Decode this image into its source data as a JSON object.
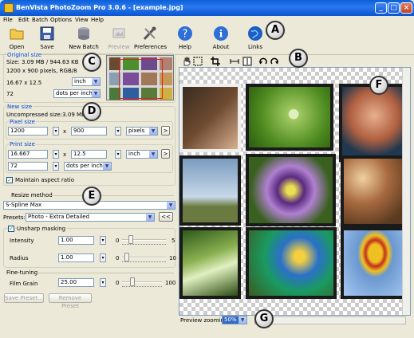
{
  "window": {
    "title": "BenVista PhotoZoom Pro 3.0.6 - [example.jpg]",
    "minimize": "_",
    "maximize": "□",
    "close": "×"
  },
  "menu": [
    "File",
    "Edit",
    "Batch",
    "Options",
    "View",
    "Help"
  ],
  "toolbar": {
    "open": "Open",
    "save": "Save",
    "new_batch": "New Batch",
    "preview": "Preview",
    "preferences": "Preferences",
    "help": "Help",
    "about": "About",
    "links": "Links"
  },
  "original_size": {
    "heading": "Original size",
    "size_line": "Size: 3.09 MB / 944.63 KB",
    "pixels_line": "1200 x 900 pixels, RGB/8",
    "dims": "16.67 x 12.5",
    "unit": "inch",
    "resolution": "72",
    "res_unit": "dots per inch"
  },
  "new_size": {
    "heading": "New size",
    "uncompressed": "Uncompressed size:3.09 MB",
    "pixel_size_label": "Pixel size",
    "px_width": "1200",
    "px_height": "900",
    "px_unit": "pixels",
    "print_size_label": "Print size",
    "print_width": "16.667",
    "print_height": "12.5",
    "print_unit": "inch",
    "print_res": "72",
    "print_res_unit": "dots per inch",
    "x": "x",
    "go": ">",
    "maintain_aspect": "Maintain aspect ratio"
  },
  "resize": {
    "heading": "Resize method",
    "method": "S-Spline Max",
    "presets_label": "Presets:",
    "preset": "Photo - Extra Detailed",
    "preset_btn": "<<",
    "unsharp_label": "Unsharp masking",
    "intensity_label": "Intensity",
    "intensity_value": "1.00",
    "intensity_min": "0",
    "intensity_max": "5",
    "intensity_level": 0.2,
    "radius_label": "Radius",
    "radius_value": "1.00",
    "radius_min": "0",
    "radius_max": "10",
    "radius_level": 0.1,
    "finetuning_label": "Fine-tuning",
    "filmgrain_label": "Film Grain",
    "filmgrain_value": "25.00",
    "filmgrain_min": "0",
    "filmgrain_max": "100",
    "filmgrain_level": 0.25,
    "save_preset": "Save Preset...",
    "remove_preset": "Remove Preset"
  },
  "preview": {
    "zoom_label": "Preview zooming:",
    "zoom_value": "50%"
  },
  "callouts": [
    "A",
    "B",
    "C",
    "D",
    "E",
    "F",
    "G"
  ]
}
